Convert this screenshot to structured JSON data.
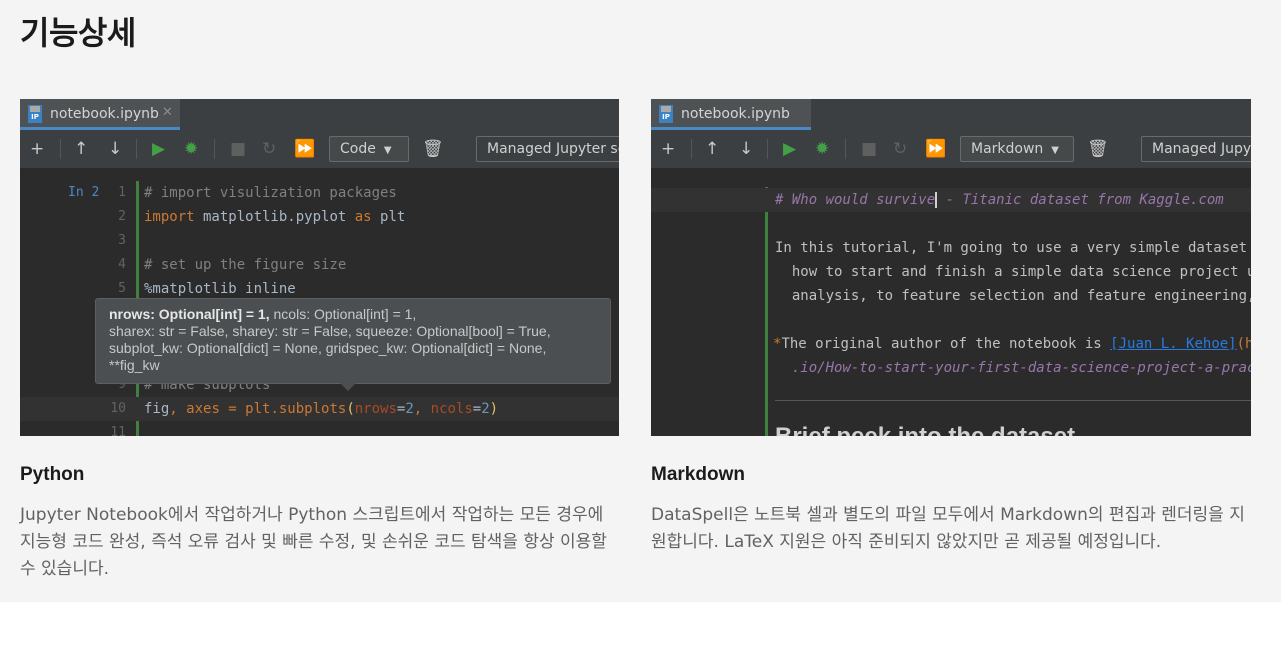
{
  "page": {
    "title": "기능상세"
  },
  "python_card": {
    "title": "Python",
    "description": "Jupyter Notebook에서 작업하거나 Python 스크립트에서 작업하는 모든 경우에 지능형 코드 완성, 즉석 오류 검사 및 빠른 수정, 및 손쉬운 코드 탐색을 항상 이용할 수 있습니다.",
    "ide": {
      "tab_name": "notebook.ipynb",
      "tab_icon_tag": "IP",
      "cell_type": "Code",
      "kernel": "Managed Jupyter se",
      "in_label": "In 2",
      "line_numbers": [
        "1",
        "2",
        "3",
        "4",
        "5",
        "9",
        "10",
        "11"
      ],
      "code": {
        "l1": "# import visulization packages",
        "l2_kw": "import",
        "l2_mod": " matplotlib.pyplot ",
        "l2_as": "as",
        "l2_alias": " plt",
        "l4": "# set up the figure size",
        "l5": "%matplotlib inline",
        "l9": "# make subplots",
        "l10_a": "fig",
        "l10_b": ", axes = plt.subplots",
        "l10_open": "(",
        "l10_p1": "nrows",
        "l10_eq1": "=",
        "l10_v1": "2",
        "l10_c": ", ",
        "l10_p2": "ncols",
        "l10_eq2": "=",
        "l10_v2": "2",
        "l10_close": ")"
      },
      "popup": {
        "bold": "nrows: Optional[int] = 1,",
        "line1_rest": " ncols: Optional[int] = 1,",
        "line2": "sharex: str = False, sharey: str = False, squeeze: Optional[bool] = True,",
        "line3": "subplot_kw: Optional[dict] = None, gridspec_kw: Optional[dict] = None,",
        "line4": "**fig_kw"
      }
    }
  },
  "markdown_card": {
    "title": "Markdown",
    "description": "DataSpell은 노트북 셀과 별도의 파일 모두에서 Markdown의 편집과 렌더링을 지원합니다. LaTeX 지원은 아직 준비되지 않았지만 곧 제공될 예정입니다.",
    "ide": {
      "tab_name": "notebook.ipynb",
      "tab_icon_tag": "IP",
      "cell_type": "Markdown",
      "kernel": "Managed Jupyt",
      "lines": {
        "h1_a": "# Who would survive",
        "h1_b": " - Titanic dataset from Kaggle.com",
        "p1": "In this tutorial, I'm going to use a very simple dataset ",
        "p2": "  how to start and finish a simple data science project u",
        "p3": "  analysis, to feature selection and feature engineering,",
        "p4_star": "*",
        "p4_text": "The original author of the notebook is ",
        "p4_link": "[Juan L. Kehoe]",
        "p4_end": "(h",
        "p5": "  .io/How-to-start-your-first-data-science-project-a-prac",
        "heading": "Brief peek into the dataset"
      }
    }
  }
}
